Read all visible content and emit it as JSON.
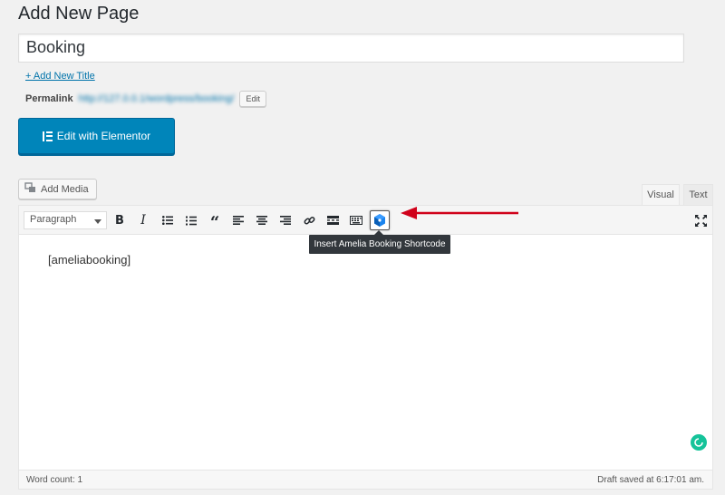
{
  "page": {
    "title": "Add New Page"
  },
  "post": {
    "title_value": "Booking",
    "add_title_link": "+ Add New Title",
    "permalink_label": "Permalink",
    "permalink_url": "http://127.0.0.1/wordpress/booking/",
    "permalink_edit": "Edit"
  },
  "elementor": {
    "button_label": "Edit with Elementor"
  },
  "media": {
    "add_media_label": "Add Media"
  },
  "editor": {
    "tabs": [
      {
        "label": "Visual",
        "active": true
      },
      {
        "label": "Text",
        "active": false
      }
    ],
    "toolbar": {
      "format_select": "Paragraph",
      "buttons": [
        "bold-icon",
        "italic-icon",
        "bulleted-list-icon",
        "numbered-list-icon",
        "blockquote-icon",
        "align-left-icon",
        "align-center-icon",
        "align-right-icon",
        "insert-link-icon",
        "read-more-icon",
        "toolbar-toggle-icon",
        "amelia-booking-icon"
      ],
      "fullscreen_icon": "fullscreen-icon"
    },
    "tooltip": "Insert Amelia Booking Shortcode",
    "content": "[ameliabooking]",
    "word_count": "Word count: 1",
    "draft_saved": "Draft saved at 6:17:01 am."
  },
  "colors": {
    "primary_button": "#0085ba",
    "link": "#0073aa",
    "annotation_arrow": "#d0021b",
    "grammarly": "#15c39a"
  }
}
